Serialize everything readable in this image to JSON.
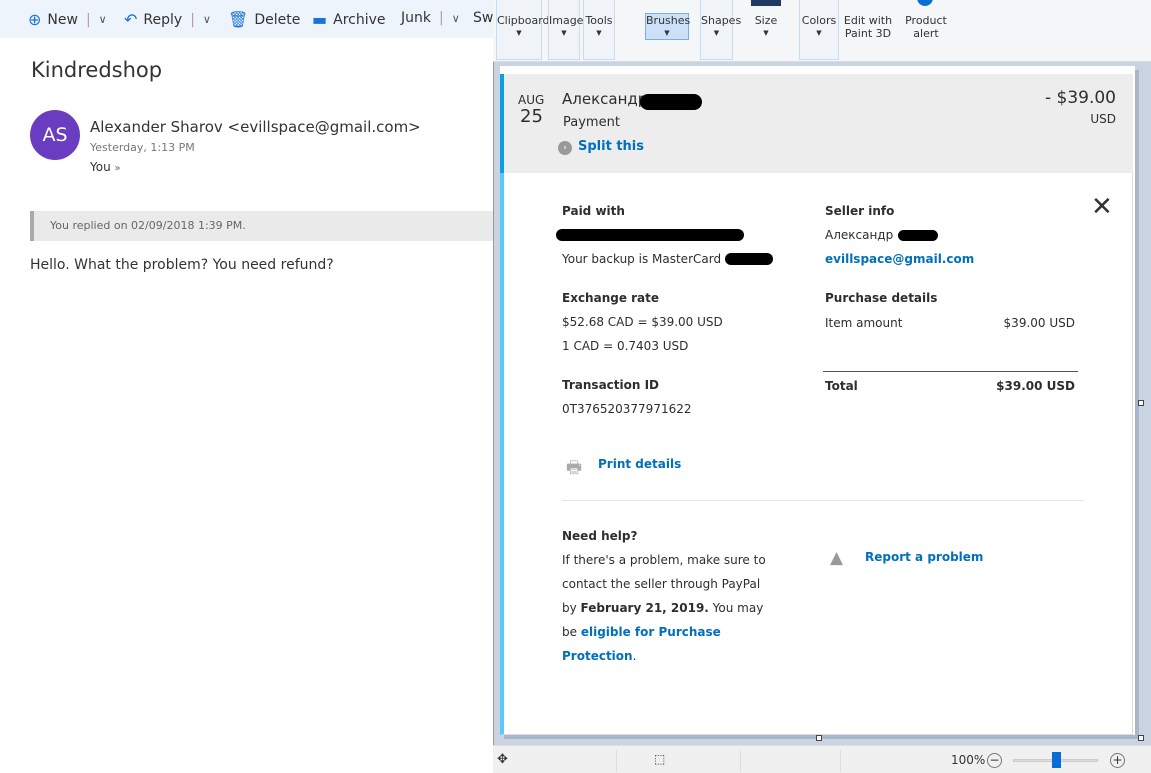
{
  "mail": {
    "toolbar": {
      "new": "New",
      "reply": "Reply",
      "delete": "Delete",
      "archive": "Archive",
      "junk": "Junk",
      "sweep": "Swe"
    },
    "subject": "Kindredshop",
    "avatar_initials": "AS",
    "sender": "Alexander Sharov <evillspace@gmail.com>",
    "time": "Yesterday, 1:13 PM",
    "to": "You",
    "replied_notice": "You replied on 02/09/2018 1:39 PM.",
    "body": "Hello. What the problem? You need refund?"
  },
  "paint": {
    "ribbon": [
      {
        "label": "Clipboard"
      },
      {
        "label": "Image"
      },
      {
        "label": "Tools"
      },
      {
        "label": "Brushes"
      },
      {
        "label": "Shapes"
      },
      {
        "label": "Size"
      },
      {
        "label": "Colors"
      },
      {
        "label": "Edit with",
        "label2": "Paint 3D"
      },
      {
        "label": "Product",
        "label2": "alert"
      }
    ],
    "status": {
      "zoom": "100%",
      "zoom_slider_percent": 50
    }
  },
  "receipt": {
    "month": "AUG",
    "day": "25",
    "name": "Александр",
    "type": "Payment",
    "split": "Split this",
    "amount": "- $39.00",
    "currency": "USD",
    "paid_with": "Paid with",
    "backup": "Your backup is MasterCard",
    "exchange_rate": "Exchange rate",
    "rate1": "$52.68 CAD = $39.00 USD",
    "rate2": "1 CAD = 0.7403 USD",
    "txn_label": "Transaction ID",
    "txn_id": "0T376520377971622",
    "print": "Print details",
    "seller_info": "Seller info",
    "seller_name": "Александр",
    "seller_email": "evillspace@gmail.com",
    "purchase_details": "Purchase details",
    "item_amount": "Item amount",
    "item_value": "$39.00 USD",
    "total": "Total",
    "total_value": "$39.00 USD",
    "need_help": "Need help?",
    "help1": "If there's a problem, make sure to",
    "help2": "contact the seller through PayPal",
    "help3a": "by ",
    "help3b": "February 21, 2019.",
    "help3c": " You may",
    "help4a": "be ",
    "help4b": "eligible for Purchase",
    "help5a": "Protection",
    "help5b": ".",
    "report": "Report a problem"
  }
}
